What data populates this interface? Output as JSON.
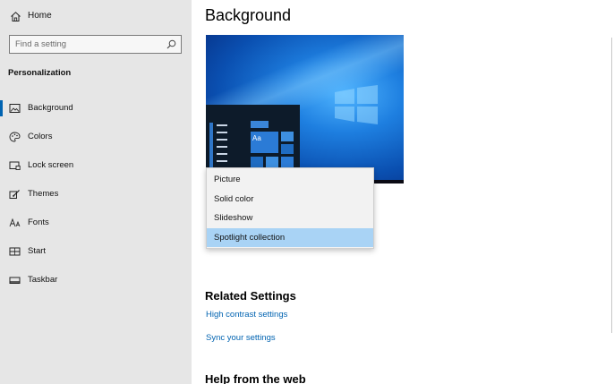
{
  "sidebar": {
    "home_label": "Home",
    "search_placeholder": "Find a setting",
    "section_title": "Personalization",
    "items": [
      {
        "label": "Background",
        "icon": "picture-icon",
        "active": true
      },
      {
        "label": "Colors",
        "icon": "palette-icon",
        "active": false
      },
      {
        "label": "Lock screen",
        "icon": "lock-screen-icon",
        "active": false
      },
      {
        "label": "Themes",
        "icon": "themes-brush-icon",
        "active": false
      },
      {
        "label": "Fonts",
        "icon": "fonts-icon",
        "active": false
      },
      {
        "label": "Start",
        "icon": "start-icon",
        "active": false
      },
      {
        "label": "Taskbar",
        "icon": "taskbar-icon",
        "active": false
      }
    ]
  },
  "main": {
    "title": "Background",
    "preview": {
      "tile_text": "Aa"
    },
    "dropdown": {
      "options": [
        "Picture",
        "Solid color",
        "Slideshow",
        "Spotlight collection"
      ],
      "selected": "Spotlight collection"
    },
    "related_settings": {
      "title": "Related Settings",
      "links": [
        "High contrast settings",
        "Sync your settings"
      ]
    },
    "help_title": "Help from the web"
  },
  "colors": {
    "sidebar_bg": "#e6e6e6",
    "accent": "#0063b1",
    "selected_option": "#a9d3f5",
    "link": "#0063b1"
  }
}
